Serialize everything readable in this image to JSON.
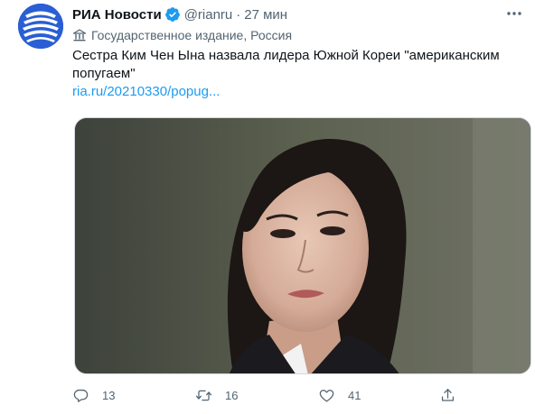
{
  "account": {
    "name": "РИА Новости",
    "handle": "@rianru",
    "separator": "·",
    "time": "27 мин"
  },
  "state_label": "Государственное издание, Россия",
  "tweet": {
    "text": "Сестра Ким Чен Ына назвала лидера Южной Кореи \"американским попугаем\"",
    "link": "ria.ru/20210330/popug..."
  },
  "media": {
    "icon": "photo-of-woman"
  },
  "actions": {
    "reply_count": "13",
    "retweet_count": "16",
    "like_count": "41"
  },
  "icons": {
    "verified": "verified-badge-icon",
    "more": "more-icon",
    "state": "state-media-icon",
    "reply": "reply-icon",
    "retweet": "retweet-icon",
    "like": "heart-icon",
    "share": "share-icon"
  },
  "colors": {
    "avatar_blue": "#2a5ed4",
    "link_blue": "#1d9bf0",
    "secondary_text": "#536471",
    "verified_blue": "#1d9bf0"
  }
}
